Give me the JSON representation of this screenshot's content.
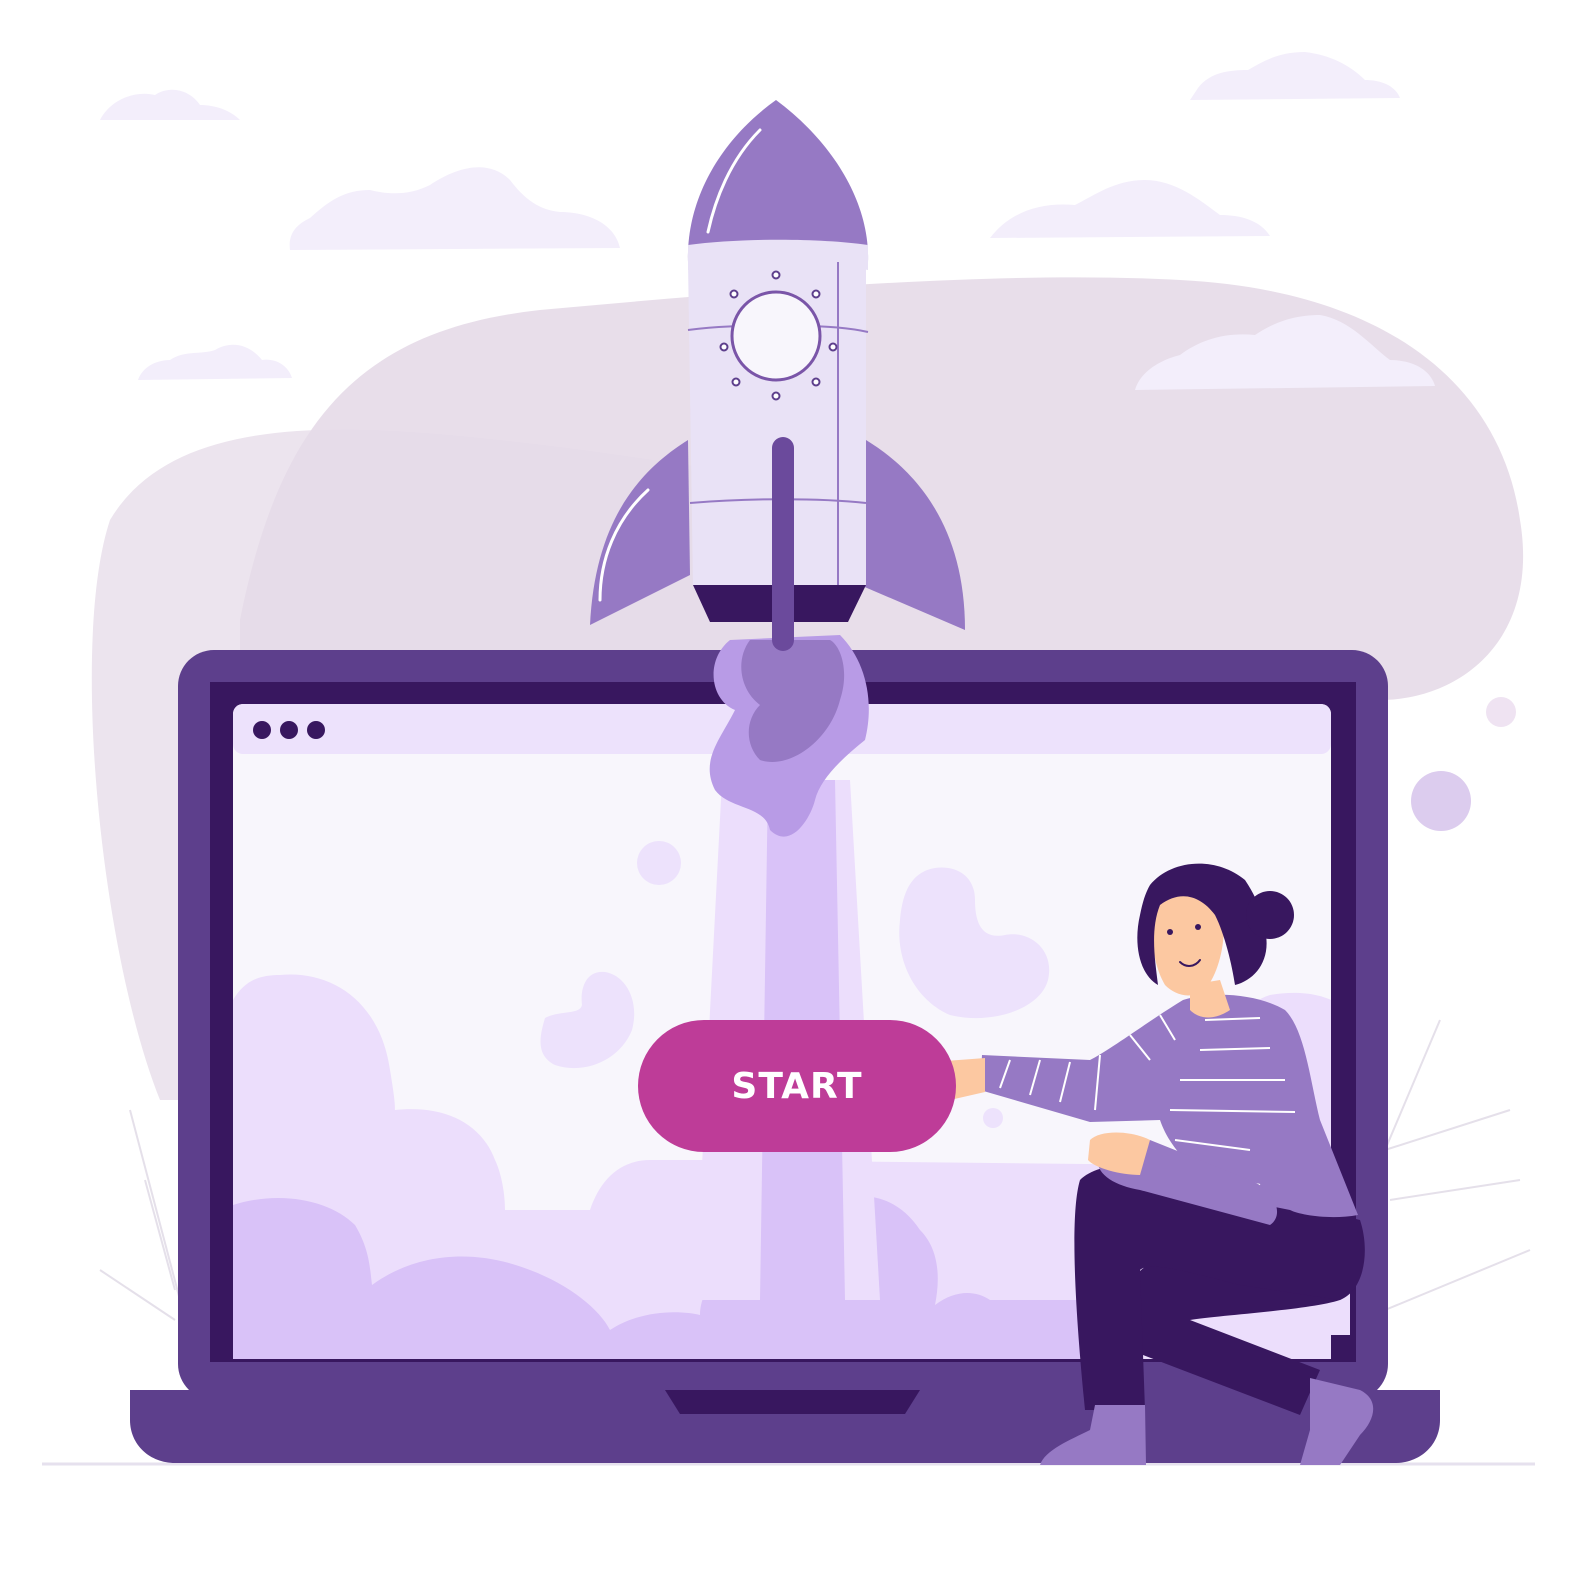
{
  "start_button": {
    "label": "START"
  },
  "browser": {
    "dots": 3
  },
  "colors": {
    "laptop_frame": "#5d3f8c",
    "laptop_dark": "#38175f",
    "screen_bg": "#f7f5fb",
    "cloud_light": "#ecdefc",
    "cloud_mid": "#d9c2f8",
    "rocket_body": "#e9e2f6",
    "rocket_accent": "#9679c4",
    "button": "#be3c98",
    "blob": "#e8dbe8"
  }
}
